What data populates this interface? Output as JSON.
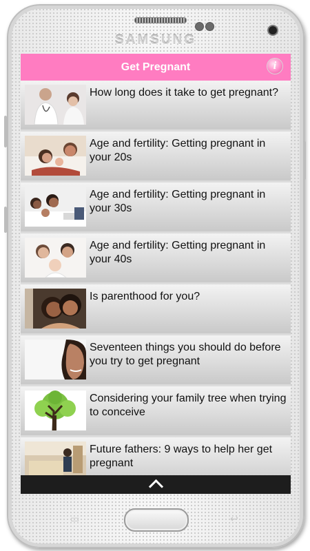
{
  "device": {
    "brand": "SAMSUNG"
  },
  "app": {
    "title": "Get Pregnant",
    "info_icon": "i",
    "accent_color": "#ff7cc1"
  },
  "articles": [
    {
      "title": "How long does it take to get pregnant?",
      "thumbnail": "doctor-patient-photo"
    },
    {
      "title": "Age and fertility: Getting pregnant in your 20s",
      "thumbnail": "couple-baby-photo"
    },
    {
      "title": "Age and fertility: Getting pregnant in your 30s",
      "thumbnail": "family-bed-photo"
    },
    {
      "title": "Age and fertility: Getting pregnant in your 40s",
      "thumbnail": "parents-baby-photo"
    },
    {
      "title": "Is parenthood for you?",
      "thumbnail": "mother-child-photo"
    },
    {
      "title": "Seventeen things you should do before you try to get pregnant",
      "thumbnail": "woman-smiling-photo"
    },
    {
      "title": "Considering your family tree when trying to conceive",
      "thumbnail": "tree-illustration"
    },
    {
      "title": "Future fathers: 9 ways to help her get pregnant",
      "thumbnail": "living-room-photo"
    }
  ],
  "bottom_bar": {
    "icon": "chevron-up-icon"
  }
}
